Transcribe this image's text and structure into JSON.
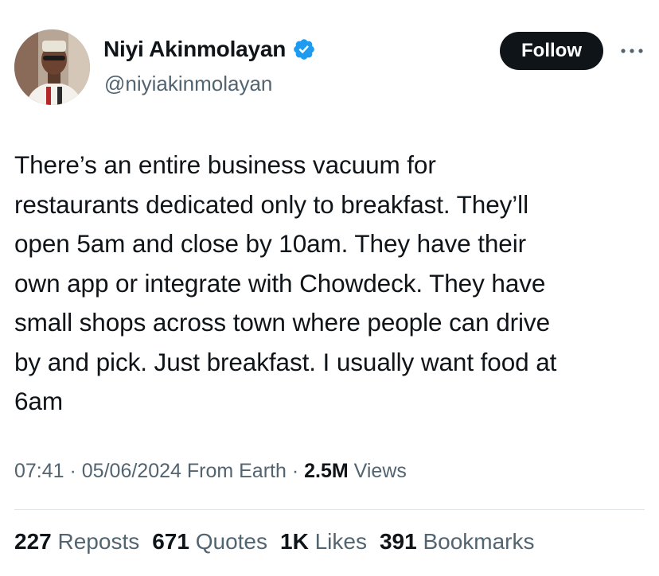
{
  "author": {
    "name": "Niyi Akinmolayan",
    "handle": "@niyiakinmolayan",
    "verified": true,
    "verified_icon": "verified-badge-icon",
    "verified_color": "#1d9bf0"
  },
  "actions": {
    "follow_label": "Follow",
    "more_icon": "more-dots-icon"
  },
  "tweet": {
    "lines": [
      "There’s an entire business vacuum for",
      "restaurants dedicated only to breakfast. They’ll",
      "open 5am and close by 10am. They have their",
      "own app or integrate with Chowdeck. They have",
      "small shops across town where people can drive",
      "by and pick. Just breakfast. I usually want food at",
      "6am"
    ]
  },
  "meta": {
    "time": "07:41",
    "sep1": " · ",
    "date": "05/06/2024",
    "location": " From Earth",
    "sep2": " · ",
    "views_count": "2.5M",
    "views_label": " Views"
  },
  "stats": {
    "reposts_count": "227",
    "reposts_label": "Reposts",
    "quotes_count": "671",
    "quotes_label": "Quotes",
    "likes_count": "1K",
    "likes_label": "Likes",
    "bookmarks_count": "391",
    "bookmarks_label": "Bookmarks"
  },
  "colors": {
    "text_primary": "#0f1419",
    "text_secondary": "#536471",
    "follow_bg": "#0f1419",
    "divider": "#e3e6e8"
  }
}
